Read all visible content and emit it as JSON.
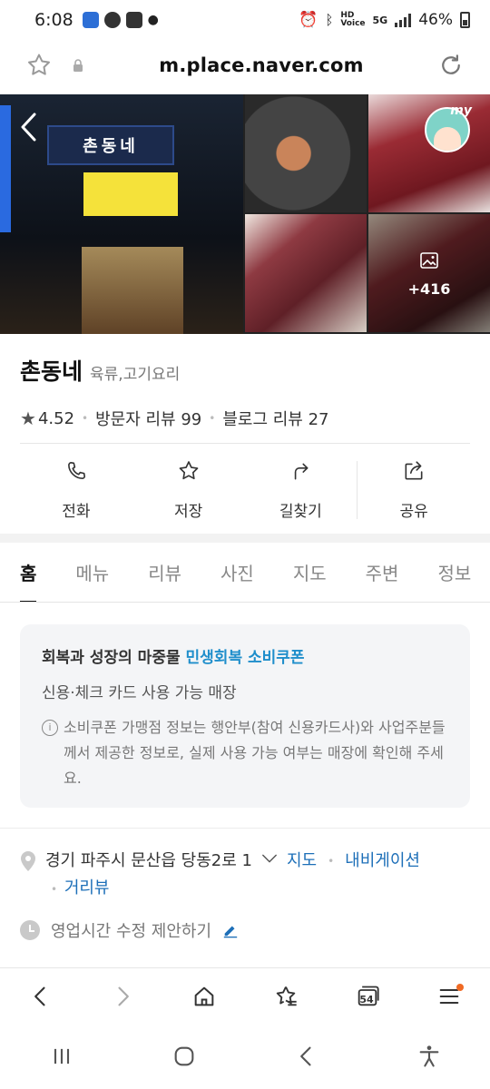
{
  "status_bar": {
    "time": "6:08",
    "network": "5G",
    "battery": "46%",
    "icons": [
      "app-icon",
      "talk-icon",
      "youtube-icon",
      "alarm-icon",
      "bluetooth-icon",
      "hd-voice-icon",
      "signal-icon",
      "battery-icon"
    ]
  },
  "browser": {
    "url": "m.place.naver.com",
    "tab_count": "54"
  },
  "gallery": {
    "sign_text": "촌동네",
    "photo_count": "+416",
    "avatar_badge": "my"
  },
  "place": {
    "name": "촌동네",
    "category": "육류,고기요리",
    "rating": "4.52",
    "visitor_reviews": "방문자 리뷰 99",
    "blog_reviews": "블로그 리뷰 27"
  },
  "actions": [
    {
      "label": "전화",
      "icon": "phone-icon"
    },
    {
      "label": "저장",
      "icon": "star-icon"
    },
    {
      "label": "길찾기",
      "icon": "directions-icon"
    },
    {
      "label": "공유",
      "icon": "share-icon"
    }
  ],
  "tabs": [
    {
      "label": "홈",
      "active": true
    },
    {
      "label": "메뉴",
      "active": false
    },
    {
      "label": "리뷰",
      "active": false
    },
    {
      "label": "사진",
      "active": false
    },
    {
      "label": "지도",
      "active": false
    },
    {
      "label": "주변",
      "active": false
    },
    {
      "label": "정보",
      "active": false
    }
  ],
  "coupon": {
    "head_prefix": "회복과 성장의 마중물",
    "head_accent": "민생회복 소비쿠폰",
    "subtitle": "신용·체크 카드 사용 가능 매장",
    "note": "소비쿠폰 가맹점 정보는 행안부(참여 신용카드사)와 사업주분들께서 제공한 정보로, 실제 사용 가능 여부는 매장에 확인해 주세요."
  },
  "address": {
    "text": "경기 파주시 문산읍 당동2로 1",
    "map_link": "지도",
    "navi_link": "내비게이션",
    "street_view_link": "거리뷰"
  },
  "hours": {
    "text": "영업시간 수정 제안하기"
  },
  "colors": {
    "accent": "#1f8ecb",
    "link": "#1d6fb8",
    "notification": "#f06a24"
  }
}
